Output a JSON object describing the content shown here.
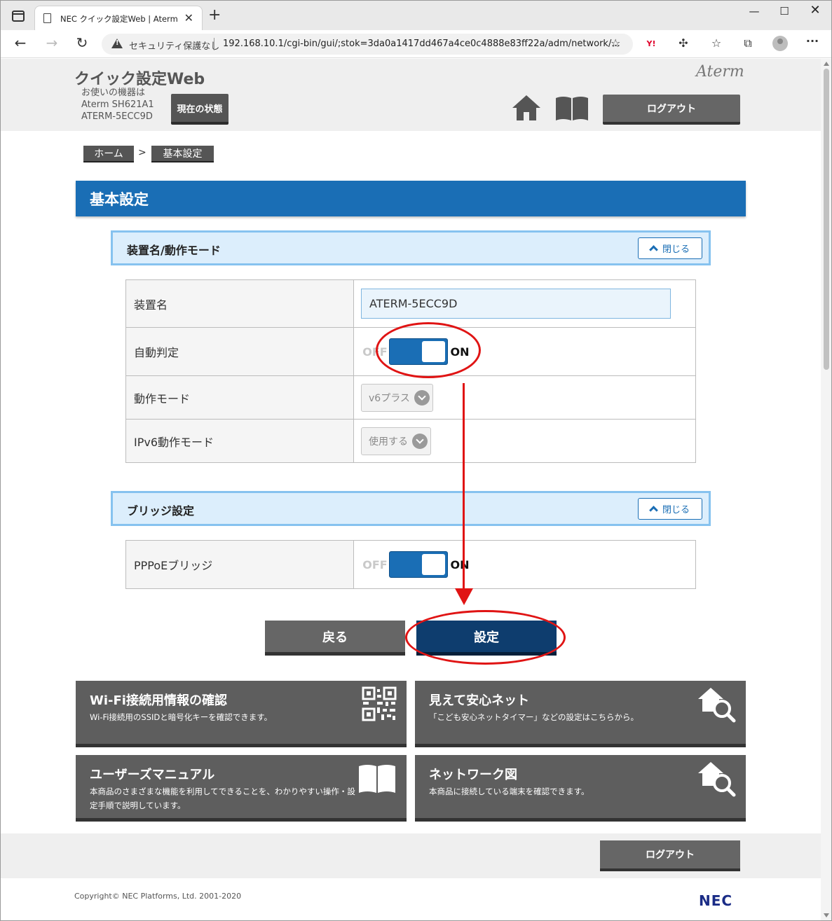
{
  "browser": {
    "tab_title": "NEC クイック設定Web | Aterm",
    "security_label": "セキュリティ保護なし",
    "url": "192.168.10.1/cgi-bin/gui/;stok=3da0a1417dd467a4ce0c4888e83ff22a/adm/network/...",
    "yahoo_label": "Y!"
  },
  "header": {
    "app_title": "クイック設定Web",
    "device_label": "お使いの機器は",
    "device_model": "Aterm SH621A1",
    "device_name": "ATERM-5ECC9D",
    "status_button": "現在の状態",
    "brand": "Aterm",
    "logout_label": "ログアウト"
  },
  "breadcrumb": {
    "home": "ホーム",
    "separator": ">",
    "current": "基本設定"
  },
  "page_title": "基本設定",
  "sections": [
    {
      "title": "装置名/動作モード",
      "close_label": "閉じる",
      "rows": [
        {
          "label": "装置名",
          "value": "ATERM-5ECC9D"
        },
        {
          "label": "自動判定",
          "off_label": "OFF",
          "on_label": "ON",
          "state": "on"
        },
        {
          "label": "動作モード",
          "value": "v6プラス"
        },
        {
          "label": "IPv6動作モード",
          "value": "使用する"
        }
      ]
    },
    {
      "title": "ブリッジ設定",
      "close_label": "閉じる",
      "rows": [
        {
          "label": "PPPoEブリッジ",
          "off_label": "OFF",
          "on_label": "ON",
          "state": "on"
        }
      ]
    }
  ],
  "actions": {
    "back_label": "戻る",
    "submit_label": "設定"
  },
  "cards": [
    {
      "title": "Wi-Fi接続用情報の確認",
      "desc": "Wi-Fi接続用のSSIDと暗号化キーを確認できます。",
      "icon": "qr-code-icon"
    },
    {
      "title": "見えて安心ネット",
      "desc": "「こども安心ネットタイマー」などの設定はこちらから。",
      "icon": "home-search-icon"
    },
    {
      "title": "ユーザーズマニュアル",
      "desc": "本商品のさまざまな機能を利用してできることを、わかりやすい操作・設定手順で説明しています。",
      "icon": "book-icon"
    },
    {
      "title": "ネットワーク図",
      "desc": "本商品に接続している端末を確認できます。",
      "icon": "home-search-icon"
    }
  ],
  "footer": {
    "logout_label": "ログアウト",
    "copyright": "Copyright© NEC Platforms, Ltd. 2001-2020",
    "brand": "NEC"
  },
  "colors": {
    "accent": "#1a6eb5",
    "annotation": "#e01414",
    "submit": "#0e3d6e"
  }
}
